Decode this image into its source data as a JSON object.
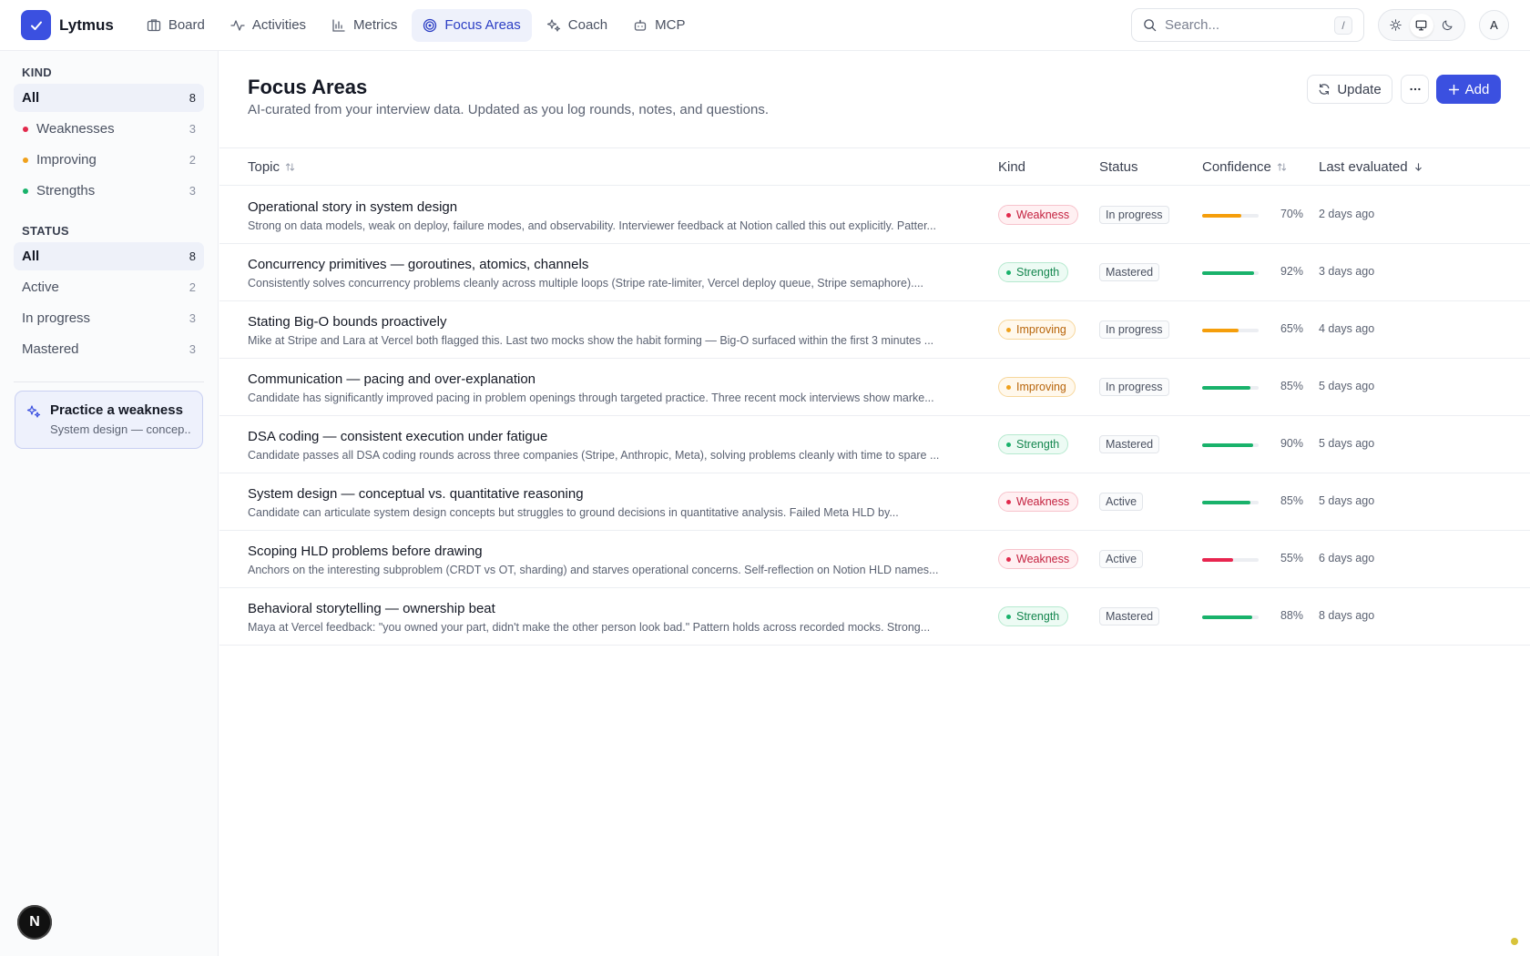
{
  "app": {
    "name": "Lytmus"
  },
  "nav": {
    "items": [
      {
        "label": "Board",
        "icon": "board-icon",
        "active": false
      },
      {
        "label": "Activities",
        "icon": "activity-icon",
        "active": false
      },
      {
        "label": "Metrics",
        "icon": "metrics-icon",
        "active": false
      },
      {
        "label": "Focus Areas",
        "icon": "target-icon",
        "active": true
      },
      {
        "label": "Coach",
        "icon": "sparkles-icon",
        "active": false
      },
      {
        "label": "MCP",
        "icon": "robot-icon",
        "active": false
      }
    ]
  },
  "search": {
    "placeholder": "Search...",
    "shortcut": "/"
  },
  "theme": {
    "options": [
      "light",
      "system",
      "dark"
    ],
    "selected": "system"
  },
  "user": {
    "avatar_initial": "A"
  },
  "sidebar": {
    "kind_title": "KIND",
    "kind_items": [
      {
        "label": "All",
        "count": "8",
        "active": true,
        "color": ""
      },
      {
        "label": "Weaknesses",
        "count": "3",
        "active": false,
        "color": "#e2294c"
      },
      {
        "label": "Improving",
        "count": "2",
        "active": false,
        "color": "#f0a11c"
      },
      {
        "label": "Strengths",
        "count": "3",
        "active": false,
        "color": "#19b26b"
      }
    ],
    "status_title": "STATUS",
    "status_items": [
      {
        "label": "All",
        "count": "8",
        "active": true
      },
      {
        "label": "Active",
        "count": "2",
        "active": false
      },
      {
        "label": "In progress",
        "count": "3",
        "active": false
      },
      {
        "label": "Mastered",
        "count": "3",
        "active": false
      }
    ],
    "practice": {
      "title": "Practice a weakness",
      "subtitle": "System design — concep..."
    },
    "badge_letter": "N"
  },
  "main": {
    "title": "Focus Areas",
    "subtitle": "AI-curated from your interview data. Updated as you log rounds, notes, and questions.",
    "update_label": "Update",
    "add_label": "Add",
    "columns": {
      "topic": "Topic",
      "kind": "Kind",
      "status": "Status",
      "confidence": "Confidence",
      "last_evaluated": "Last evaluated"
    },
    "rows": [
      {
        "title": "Operational story in system design",
        "desc": "Strong on data models, weak on deploy, failure modes, and observability. Interviewer feedback at Notion called this out explicitly. Patter...",
        "kind": "Weakness",
        "status": "In progress",
        "confidence": 70,
        "confidence_label": "70%",
        "last": "2 days ago"
      },
      {
        "title": "Concurrency primitives — goroutines, atomics, channels",
        "desc": "Consistently solves concurrency problems cleanly across multiple loops (Stripe rate-limiter, Vercel deploy queue, Stripe semaphore)....",
        "kind": "Strength",
        "status": "Mastered",
        "confidence": 92,
        "confidence_label": "92%",
        "last": "3 days ago"
      },
      {
        "title": "Stating Big-O bounds proactively",
        "desc": "Mike at Stripe and Lara at Vercel both flagged this. Last two mocks show the habit forming — Big-O surfaced within the first 3 minutes ...",
        "kind": "Improving",
        "status": "In progress",
        "confidence": 65,
        "confidence_label": "65%",
        "last": "4 days ago"
      },
      {
        "title": "Communication — pacing and over-explanation",
        "desc": "Candidate has significantly improved pacing in problem openings through targeted practice. Three recent mock interviews show marke...",
        "kind": "Improving",
        "status": "In progress",
        "confidence": 85,
        "confidence_label": "85%",
        "last": "5 days ago"
      },
      {
        "title": "DSA coding — consistent execution under fatigue",
        "desc": "Candidate passes all DSA coding rounds across three companies (Stripe, Anthropic, Meta), solving problems cleanly with time to spare ...",
        "kind": "Strength",
        "status": "Mastered",
        "confidence": 90,
        "confidence_label": "90%",
        "last": "5 days ago"
      },
      {
        "title": "System design — conceptual vs. quantitative reasoning",
        "desc": "Candidate can articulate system design concepts but struggles to ground decisions in quantitative analysis. Failed Meta HLD by...",
        "kind": "Weakness",
        "status": "Active",
        "confidence": 85,
        "confidence_label": "85%",
        "last": "5 days ago"
      },
      {
        "title": "Scoping HLD problems before drawing",
        "desc": "Anchors on the interesting subproblem (CRDT vs OT, sharding) and starves operational concerns. Self-reflection on Notion HLD names...",
        "kind": "Weakness",
        "status": "Active",
        "confidence": 55,
        "confidence_label": "55%",
        "last": "6 days ago"
      },
      {
        "title": "Behavioral storytelling — ownership beat",
        "desc": "Maya at Vercel feedback: \"you owned your part, didn't make the other person look bad.\" Pattern holds across recorded mocks. Strong...",
        "kind": "Strength",
        "status": "Mastered",
        "confidence": 88,
        "confidence_label": "88%",
        "last": "8 days ago"
      }
    ]
  },
  "colors": {
    "accent": "#3b50e0",
    "confidence_high": "#19b26b",
    "confidence_mid": "#f59e0b",
    "confidence_low": "#e8254f"
  }
}
